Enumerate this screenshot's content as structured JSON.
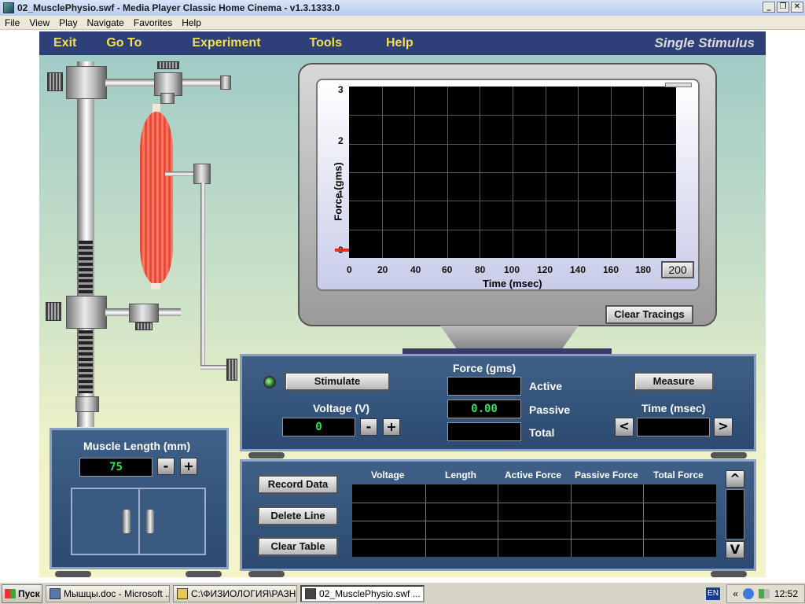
{
  "window": {
    "title": "02_MusclePhysio.swf - Media Player Classic Home Cinema - v1.3.1333.0"
  },
  "menubar": [
    "File",
    "View",
    "Play",
    "Navigate",
    "Favorites",
    "Help"
  ],
  "app_menu": {
    "items": [
      "Exit",
      "Go To",
      "Experiment",
      "Tools",
      "Help"
    ],
    "mode": "Single Stimulus"
  },
  "oscilloscope": {
    "ylabel": "Force (gms)",
    "xlabel": "Time (msec)",
    "yticks": [
      "3",
      "2",
      "1",
      "0"
    ],
    "xticks": [
      "0",
      "20",
      "40",
      "60",
      "80",
      "100",
      "120",
      "140",
      "160",
      "180"
    ],
    "xmax_button": "200",
    "clear_button": "Clear Tracings"
  },
  "stim_panel": {
    "stimulate": "Stimulate",
    "voltage_label": "Voltage (V)",
    "voltage_value": "0",
    "force_label": "Force (gms)",
    "active_label": "Active",
    "passive_label": "Passive",
    "total_label": "Total",
    "active_value": "",
    "passive_value": "0.00",
    "total_value": "",
    "measure": "Measure",
    "time_label": "Time (msec)",
    "time_value": "",
    "minus": "-",
    "plus": "+",
    "prev": "<",
    "next": ">"
  },
  "length_panel": {
    "label": "Muscle Length (mm)",
    "value": "75",
    "minus": "-",
    "plus": "+"
  },
  "data_panel": {
    "record": "Record Data",
    "delete": "Delete Line",
    "clear": "Clear Table",
    "columns": [
      "Voltage",
      "Length",
      "Active Force",
      "Passive Force",
      "Total Force"
    ],
    "scroll_up": "^",
    "scroll_down": "V"
  },
  "taskbar": {
    "start": "Пуск",
    "tasks": [
      "Мышцы.doc - Microsoft ...",
      "C:\\ФИЗИОЛОГИЯ\\РАЗН...",
      "02_MusclePhysio.swf ..."
    ],
    "lang": "EN",
    "clock": "12:52",
    "tray_arrow": "«"
  }
}
